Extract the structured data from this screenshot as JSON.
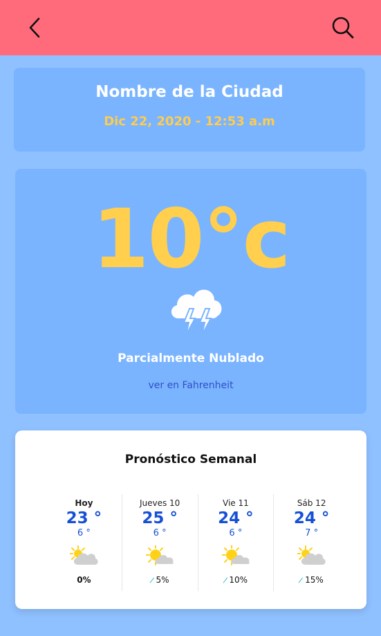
{
  "header": {
    "back_icon": "chevron-left-icon",
    "search_icon": "search-icon",
    "background_color": "#ff6b7b"
  },
  "city": {
    "name": "Nombre de la Ciudad",
    "datetime": "Dic 22, 2020 - 12:53 a.m"
  },
  "current": {
    "temperature": "10°c",
    "icon": "thunderstorm-cloud-icon",
    "description": "Parcialmente Nublado",
    "unit_link": "ver en Fahrenheit"
  },
  "weekly": {
    "title": "Pronóstico Semanal",
    "days": [
      {
        "name": "Hoy",
        "high": "23 °",
        "low": "6 °",
        "icon": "partly-cloudy-icon",
        "rain": "0%"
      },
      {
        "name": "Jueves 10",
        "high": "25 °",
        "low": "6 °",
        "icon": "partly-cloudy-icon",
        "rain": "5%"
      },
      {
        "name": "Vie 11",
        "high": "24 °",
        "low": "6 °",
        "icon": "partly-cloudy-icon",
        "rain": "10%"
      },
      {
        "name": "Sáb 12",
        "high": "24 °",
        "low": "7 °",
        "icon": "partly-cloudy-icon",
        "rain": "15%"
      }
    ]
  },
  "colors": {
    "background": "#8fc0ff",
    "card": "#7ab4ff",
    "accent_yellow": "#ffcc4d",
    "temp_blue": "#1550d6"
  }
}
